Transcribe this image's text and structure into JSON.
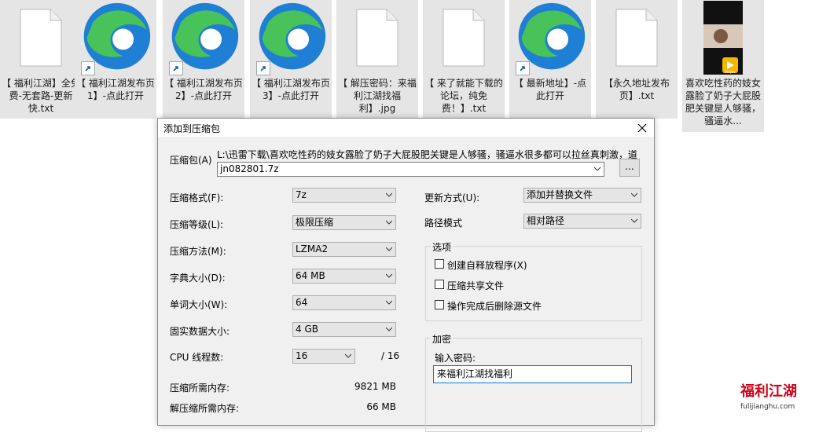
{
  "files": [
    {
      "type": "txt",
      "label": "【 福利江湖】全免费-无套路-更新快.txt"
    },
    {
      "type": "edge",
      "label": "【 福利江湖发布页1】-点此打开"
    },
    {
      "type": "edge",
      "label": "【 福利江湖发布页2】-点此打开"
    },
    {
      "type": "edge",
      "label": "【 福利江湖发布页3】-点此打开"
    },
    {
      "type": "doc",
      "label": "【 解压密码：来福利江湖找福利】.jpg"
    },
    {
      "type": "txt",
      "label": "【 来了就能下载的论坛，纯免费！】.txt"
    },
    {
      "type": "edge",
      "label": "【 最新地址】-点此打开"
    },
    {
      "type": "txt",
      "label": "【永久地址发布页】.txt"
    },
    {
      "type": "video",
      "label": "喜欢吃性药的妓女露脸了奶子大屁股肥关键是人够骚，骚逼水...",
      "badge": "Player"
    }
  ],
  "dialog": {
    "title": "添加到压缩包",
    "archive_label": "压缩包(A)",
    "archive_path": "L:\\迅雷下载\\喜欢吃性药的妓女露脸了奶子大屁股肥关键是人够骚，骚逼水很多都可以拉丝真刺激，道",
    "archive_name": "jn082801.7z",
    "browse_label": "...",
    "format_label": "压缩格式(F):",
    "format_value": "7z",
    "level_label": "压缩等级(L):",
    "level_value": "极限压缩",
    "method_label": "压缩方法(M):",
    "method_value": "LZMA2",
    "dict_label": "字典大小(D):",
    "dict_value": "64 MB",
    "word_label": "单词大小(W):",
    "word_value": "64",
    "solid_label": "固实数据大小:",
    "solid_value": "4 GB",
    "cpu_label": "CPU 线程数:",
    "cpu_value": "16",
    "cpu_total": "/ 16",
    "mem_comp_label": "压缩所需内存:",
    "mem_comp_value": "9821 MB",
    "mem_decomp_label": "解压缩所需内存:",
    "mem_decomp_value": "66 MB",
    "update_label": "更新方式(U):",
    "update_value": "添加并替换文件",
    "path_label": "路径模式",
    "path_value": "相对路径",
    "options_title": "选项",
    "opt_sfx": "创建自释放程序(X)",
    "opt_shared": "压缩共享文件",
    "opt_delete": "操作完成后删除源文件",
    "encrypt_title": "加密",
    "password_label": "输入密码:",
    "password_value": "来福利江湖找福利"
  },
  "watermark": {
    "text": "福利江湖",
    "url": "fulijianghu.com"
  },
  "colors": {
    "edge_blue": "#1e7fd4",
    "edge_green": "#47c35a",
    "accent": "#0078d7",
    "selected_bg": "#e5e5e5"
  }
}
